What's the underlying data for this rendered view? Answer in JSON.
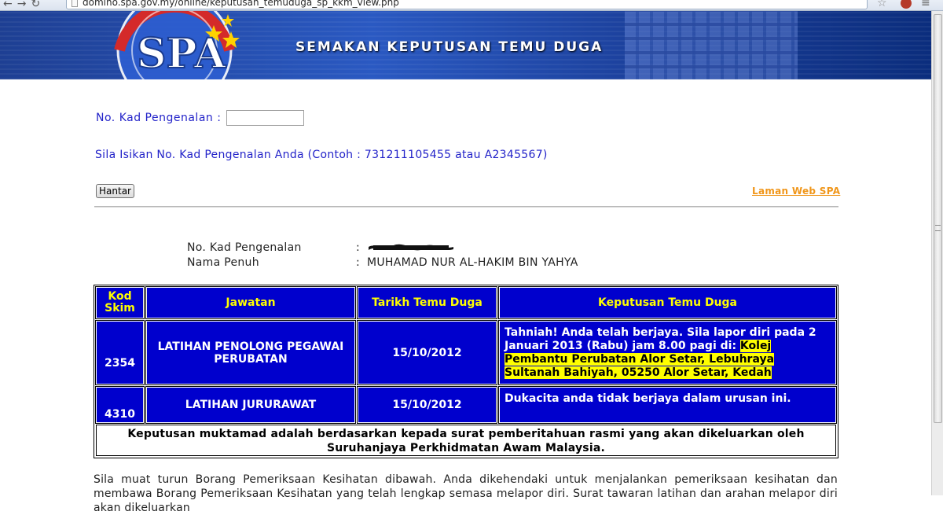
{
  "browser": {
    "url": "domino.spa.gov.my/online/keputusan_temuduga_sp_kkm_view.php"
  },
  "banner": {
    "title": "SEMAKAN KEPUTUSAN TEMU DUGA",
    "logo_text": "SPA"
  },
  "form": {
    "ic_label": "No. Kad Pengenalan :",
    "ic_value": "",
    "hint": "Sila Isikan No. Kad Pengenalan Anda (Contoh : 731211105455 atau A2345567)",
    "submit_label": "Hantar",
    "website_link": "Laman Web SPA"
  },
  "applicant": {
    "ic_label": "No. Kad Pengenalan",
    "ic_colon": ":",
    "name_label": "Nama Penuh",
    "name_colon": ":",
    "name_value": "MUHAMAD NUR AL-HAKIM BIN YAHYA"
  },
  "results": {
    "headers": {
      "kod_skim": "Kod Skim",
      "jawatan": "Jawatan",
      "tarikh": "Tarikh Temu Duga",
      "keputusan": "Keputusan Temu Duga"
    },
    "rows": [
      {
        "kod": "2354",
        "jawatan": "LATIHAN PENOLONG PEGAWAI PERUBATAN",
        "tarikh": "15/10/2012",
        "keputusan": "Tahniah! Anda telah berjaya. Sila lapor diri pada 2 Januari 2013 (Rabu) jam 8.00 pagi di:",
        "keputusan_highlight": "Kolej Pembantu Perubatan Alor Setar, Lebuhraya Sultanah Bahiyah, 05250 Alor Setar, Kedah"
      },
      {
        "kod": "4310",
        "jawatan": "LATIHAN JURURAWAT",
        "tarikh": "15/10/2012",
        "keputusan": "Dukacita anda tidak berjaya dalam urusan ini."
      }
    ],
    "footer": "Keputusan muktamad adalah berdasarkan kepada surat pemberitahuan rasmi yang akan dikeluarkan oleh Suruhanjaya Perkhidmatan Awam Malaysia."
  },
  "instructions": "Sila muat turun Borang Pemeriksaan Kesihatan dibawah. Anda dikehendaki untuk menjalankan pemeriksaan kesihatan dan membawa Borang Pemeriksaan Kesihatan yang telah lengkap semasa melapor diri. Surat tawaran latihan dan arahan melapor diri akan dikeluarkan",
  "colors": {
    "table_blue": "#0000cd",
    "header_yellow": "#ffff00",
    "label_blue": "#2323c9",
    "link_orange": "#f0961a"
  }
}
